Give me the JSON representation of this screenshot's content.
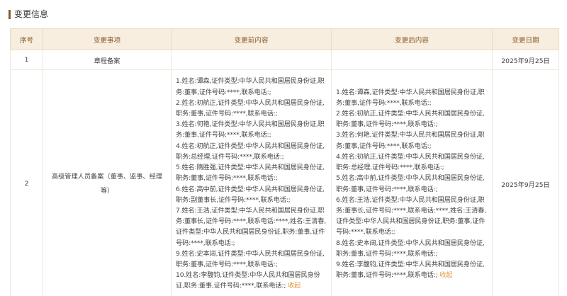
{
  "section": {
    "title": "变更信息"
  },
  "table": {
    "headers": {
      "seq": "序号",
      "item": "变更事项",
      "before": "变更前内容",
      "after": "变更后内容",
      "date": "变更日期"
    },
    "rows": [
      {
        "seq": "1",
        "item": "章程备案",
        "before_entries": [],
        "after_entries": [],
        "date": "2025年9月25日"
      },
      {
        "seq": "2",
        "item": "高级管理人员备案（董事、监事、经理等）",
        "before_entries": [
          "1.姓名:谭森,证件类型:中华人民共和国居民身份证,职务:董事,证件号码:****,联系电话:;",
          "2.姓名:初航正,证件类型:中华人民共和国居民身份证,职务:董事,证件号码:****,联系电话:;",
          "3.姓名:何艳,证件类型:中华人民共和国居民身份证,职务:董事,证件号码:****,联系电话:;",
          "4.姓名:初航正,证件类型:中华人民共和国居民身份证,职务:总经理,证件号码:****,联系电话:;",
          "5.姓名:隋胜强,证件类型:中华人民共和国居民身份证,职务:董事,证件号码:****,联系电话:;",
          "6.姓名:高中前,证件类型:中华人民共和国居民身份证,职务:副董事长,证件号码:****,联系电话:;",
          "7.姓名:王浩,证件类型:中华人民共和国居民身份证,职务:董事长,证件号码:****,联系电话:****,姓名:王清春,证件类型:中华人民共和国居民身份证,职务:董事,证件号码:****,联系电话:;",
          "9.姓名:史本阔,证件类型:中华人民共和国居民身份证,职务:董事,证件号码:****,联系电话:;",
          "10.姓名:李馥钧,证件类型:中华人民共和国居民身份证,职务:董事,证件号码:****,联系电话:;"
        ],
        "after_entries": [
          "1.姓名:谭森,证件类型:中华人民共和国居民身份证,职务:董事,证件号码:****,联系电话:;",
          "2.姓名:初航正,证件类型:中华人民共和国居民身份证,职务:董事,证件号码:****,联系电话:;",
          "3.姓名:何艳,证件类型:中华人民共和国居民身份证,职务:董事,证件号码:****,联系电话:;",
          "4.姓名:初航正,证件类型:中华人民共和国居民身份证,职务:总经理,证件号码:****,联系电话:;",
          "5.姓名:高中前,证件类型:中华人民共和国居民身份证,职务:董事,证件号码:****,联系电话:;",
          "6.姓名:王浩,证件类型:中华人民共和国居民身份证,职务:董事长,证件号码:****,联系电话:****,姓名:王清春,证件类型:中华人民共和国居民身份证,职务:董事,证件号码:****,联系电话:;",
          "8.姓名:史本阔,证件类型:中华人民共和国居民身份证,职务:董事,证件号码:****,联系电话:;",
          "9.姓名:李馥钧,证件类型:中华人民共和国居民身份证,职务:董事,证件号码:****,联系电话:;"
        ],
        "date": "2025年9月25日"
      }
    ],
    "collapse_label": "收起"
  }
}
